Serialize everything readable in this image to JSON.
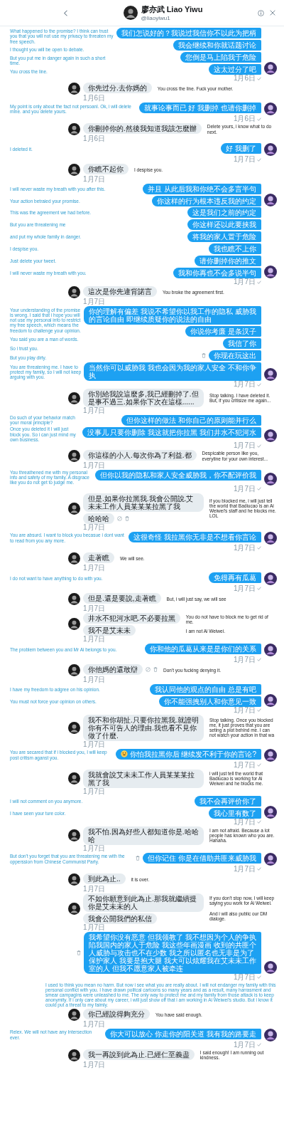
{
  "header": {
    "name": "廖亦武 Liao Yiwu",
    "handle": "@liaoyiwu1"
  },
  "blocks": [
    {
      "kind": "sent",
      "date": "1月6日",
      "read": true,
      "bubbles": [
        {
          "text": "我们怎说好的？我说过我信你不以此为把柄"
        },
        {
          "text": "我会继续和你就话题讨论"
        },
        {
          "text": "您倒是马上陷我于危险"
        },
        {
          "text": "这太过分了吧"
        }
      ],
      "notes": [
        "What happened to the promise? I think can trust you that you will not use my privacy to threaten my free speech.",
        "I thought you will be open to debate.",
        "But you put me in danger again in such a short time.",
        "You cross the line."
      ]
    },
    {
      "kind": "received",
      "date": "1月6日",
      "bubbles": [
        {
          "text": "你先过分.去你媽的"
        }
      ],
      "notes": [
        "You cross the line. Fuck your mother."
      ]
    },
    {
      "kind": "sent",
      "date": "1月6日",
      "read": true,
      "bubbles": [
        {
          "text": "就事论事而已 好 我删掉 也请你删掉"
        }
      ],
      "notes": [
        "My point is only about the fact not persoanl. Ok, i will delete mine. and you delete yours."
      ]
    },
    {
      "kind": "received",
      "date": "1月6日",
      "bubbles": [
        {
          "text": "你刪掉你的.然後我知道我該怎麼辦"
        }
      ],
      "notes": [
        "Delete yours, i know what to do next."
      ]
    },
    {
      "kind": "sent",
      "date": "1月7日",
      "read": true,
      "bubbles": [
        {
          "text": "好 我删了"
        }
      ],
      "notes": [
        "I deleted it."
      ]
    },
    {
      "kind": "received",
      "date": "1月7日",
      "bubbles": [
        {
          "text": "你瞧不起你"
        }
      ],
      "notes": [
        "I despise you."
      ]
    },
    {
      "kind": "sent",
      "bubbles": [
        {
          "text": "并且 从此后我和你绝不会多言半句"
        },
        {
          "text": "你这样的行为根本违反我的约定"
        }
      ],
      "notes": [
        "I will never waste my breath with you after this.",
        "Your action betraied your promise."
      ]
    },
    {
      "kind": "sent",
      "date": "1月7日",
      "read": true,
      "bubbles": [
        {
          "text": "这是我们之前的约定"
        },
        {
          "text": "你这样还以此要挟我"
        },
        {
          "text": "将我的家人置于危险"
        },
        {
          "text": "我也瞧不上你"
        },
        {
          "text": "请你删掉你的推文"
        },
        {
          "text": "我和你再也不会多说半句"
        }
      ],
      "notes": [
        "This was the agreement we had before.",
        "But you are threatening me",
        "and put my whole family in danger.",
        "I despise you.",
        "Just delete your tweet.",
        "I will never waste my breath with you."
      ]
    },
    {
      "kind": "received",
      "date": "1月7日",
      "bubbles": [
        {
          "text": "這次是你先違背諾言"
        }
      ],
      "notes": [
        "You broke the agreement first."
      ]
    },
    {
      "kind": "sent",
      "date": "1月7日",
      "read": true,
      "bubbles": [
        {
          "lines": [
            "你的理解有偏差 我说不希望你以我工作的隐私 威胁我",
            "的言论自由 即继续质疑你的说法的自由"
          ]
        },
        {
          "text": "你说你考廉 是条汉子"
        },
        {
          "text": "我信了你"
        },
        {
          "text": "你现在玩这出",
          "trash_icon": true
        },
        {
          "lines": [
            "当然你可以威胁我 我也会因为我的家人安全 不和你争",
            "执"
          ]
        }
      ],
      "notes": [
        "Your understanding of the promise is wrong. I said that i hope you will not use my personal info to restrict my free speech, which means the freedom to challenge your opinion.",
        "You said you are  a man of words.",
        "So i trust you.",
        "But you play dirty.",
        "You are threatening me. I have to protect my family, so I will not keep arguing with you."
      ]
    },
    {
      "kind": "received",
      "date": "1月7日",
      "bubbles": [
        {
          "text": "你別給我說這麼多,我已經刪掉了.但是事不過三.如果你下次在這樣......"
        }
      ],
      "notes": [
        "Stop talking. I have deleted it. But, if you critisize me again..."
      ]
    },
    {
      "kind": "sent",
      "date": "1月7日",
      "read": true,
      "bubbles": [
        {
          "text": "但你这样的做法 和你自己的原则能并行么"
        },
        {
          "lines": [
            "没事儿 只要你删除 我这就把你拉黑 我们井水不犯河水"
          ]
        }
      ],
      "notes": [
        "Do such of your behavior match your moral principle?",
        "Once you deleted it I will just block you. So i can just mind my own business."
      ]
    },
    {
      "kind": "received",
      "date": "1月7日",
      "bubbles": [
        {
          "text": "你這樣的小人.每次你為了利益.都"
        }
      ],
      "notes": [
        "Despicable person like you, everytine for your own interest..."
      ]
    },
    {
      "kind": "sent",
      "date": "1月7日",
      "read": true,
      "bubbles": [
        {
          "text": "但你以我的隐私和家人安全威胁我，你不配评价我"
        }
      ],
      "notes": [
        "You threathened me with my personal info and safety of my family. A disgrace like you do not get to judge me."
      ]
    },
    {
      "kind": "received",
      "date": "1月7日",
      "bubbles": [
        {
          "text": "但是.如果你拉黑我.我會公開說.艾未未工作人員某某某拉黑了我"
        },
        {
          "text": "哈哈哈",
          "block_icon": true,
          "trash_icon": true
        }
      ],
      "notes": [
        "if you blocked me, i will just tell the world that Badiucao is an Ai Weiwei's staff and he blocks me. LOL"
      ]
    },
    {
      "kind": "sent",
      "date": "1月7日",
      "read": true,
      "bubbles": [
        {
          "text": "这很奇怪 我拉黑你无非是不想看你言论"
        }
      ],
      "notes": [
        "You are absurd. I want to block you becasue i dont want to read from you any more."
      ]
    },
    {
      "kind": "received",
      "date": "1月7日",
      "bubbles": [
        {
          "text": "走著瞧"
        }
      ],
      "notes": [
        "We will see."
      ]
    },
    {
      "kind": "sent",
      "date": "1月7日",
      "read": true,
      "bubbles": [
        {
          "text": "免得再有瓜葛"
        }
      ],
      "notes": [
        "I do not want to have anything to do with you."
      ]
    },
    {
      "kind": "received",
      "date": "1月7日",
      "bubbles": [
        {
          "text": "但是.還是要說,走著瞧"
        }
      ],
      "notes": [
        "But, i will just say, we will see"
      ]
    },
    {
      "kind": "received",
      "date": "1月7日",
      "bubbles": [
        {
          "text": "井水不犯河水吧.不必要拉黑"
        },
        {
          "text": "我不是艾未未"
        }
      ],
      "notes": [
        "You do not have to block me to get rid of me.",
        "I am not Ai Weiwei."
      ]
    },
    {
      "kind": "sent",
      "date": "1月7日",
      "read": true,
      "bubbles": [
        {
          "text": "你和他的瓜葛从来是是你们的关系"
        }
      ],
      "notes": [
        "The problem between you and Mr Ai belongs to you."
      ]
    },
    {
      "kind": "received",
      "date": "1月7日",
      "bubbles": [
        {
          "text": "你他媽的還敢辯",
          "block_icon": true,
          "trash_icon": true
        }
      ],
      "notes": [
        "Don't you fucking denying it."
      ]
    },
    {
      "kind": "sent",
      "date": "1月7日",
      "read": true,
      "bubbles": [
        {
          "text": "我认同他的观点的自由 总是有吧"
        },
        {
          "text": "你不能强拽别人和你意见一致"
        }
      ],
      "notes": [
        "I have my freedom to adgree on his opinion.",
        "You must not force your opinion on others."
      ]
    },
    {
      "kind": "received",
      "date": "1月7日",
      "bubbles": [
        {
          "text": "我不和你胡扯.只要你拉黑我.就證明你有不可告人的理由.我也看不見你做了什麼."
        }
      ],
      "notes": [
        "Stop talking. Once you blocked me, it just proves that you are seting a plot behind me. I can not watch your action in that wa"
      ]
    },
    {
      "kind": "sent",
      "date": "1月7日",
      "read": true,
      "bubbles": [
        {
          "text": "你怕我拉黑你后 继续发不利于你的言论?",
          "smiley_icon": true
        }
      ],
      "notes": [
        "You are secared that if i blocked you, I will keep post critism aganst you."
      ]
    },
    {
      "kind": "received",
      "date": "1月7日",
      "bubbles": [
        {
          "text": "我就會說艾未未工作人員某某某拉黑了我"
        }
      ],
      "notes": [
        "i will just tell the world that Badiucao is working for Ai Weiwei and he blocks me."
      ]
    },
    {
      "kind": "sent",
      "date": "1月7日",
      "read": true,
      "bubbles": [
        {
          "text": "我不会再评价你了"
        },
        {
          "text": "我心里有数了"
        }
      ],
      "notes": [
        "I will not comment on you anymore.",
        "I have seen your ture color."
      ]
    },
    {
      "kind": "received",
      "date": "1月7日",
      "bubbles": [
        {
          "text": "我不怕.因為好些人都知道你是.哈哈哈"
        }
      ],
      "notes": [
        "I am not afraid. Because a lot people has known who you are. Hahaha."
      ]
    },
    {
      "kind": "sent",
      "date": "1月7日",
      "read": true,
      "bubbles": [
        {
          "text": "但你记住 你是在借助共匪来威胁我",
          "trash_icon": true
        }
      ],
      "notes": [
        "But don't you forget that you are threatening me with the opperssion from Chinese Communist Party."
      ]
    },
    {
      "kind": "received",
      "date": "1月7日",
      "bubbles": [
        {
          "text": "到此為止.."
        }
      ],
      "notes": [
        "it is over."
      ]
    },
    {
      "kind": "received",
      "date": "1月7日",
      "bubbles": [
        {
          "text": "不如你願意到此為止.那我就繼續提你是艾未未的人"
        },
        {
          "text": "我會公開我們的私信"
        }
      ],
      "notes": [
        "If you don't stop now, I will keep saying you work for Ai Weiwei.",
        "And i will also public our DM dialoge."
      ]
    },
    {
      "kind": "sent",
      "date": "1月7日",
      "read": true,
      "bubbles": [
        {
          "lines": [
            "我希望你没有恶意 但我领教了 我不想因为个人的争执",
            "陷我国内的家人于危险 我这些年画漫画 收到的共匪个",
            "人威胁与攻击也不在少数 我之所以匿名也无非是为了",
            "保护家人  我要是抱大腿 我大可以炫耀我在艾未未工作",
            "室的人 但我不愿意家人被牵连"
          ],
          "trash_icon": true
        }
      ],
      "notes_below": [
        "I used to think you mean no harm. But now i see what you are really about. I will not endanger my family with this personal conflict with you. I have drawn politcal cartoons so many years and as a result, many harrasment and smear campagins were unleashed to me. The only way to protect me and my family from those attack is to keep anonymity. If i only care about my career, i will just show off that i am working in Ai Weiwei's studio. But i know it could put a threat to my faimly."
      ]
    },
    {
      "kind": "received",
      "date": "1月7日",
      "bubbles": [
        {
          "text": "你已經說得夠充分"
        }
      ],
      "notes": [
        "You have said enough."
      ]
    },
    {
      "kind": "sent",
      "date": "1月7日",
      "read": true,
      "bubbles": [
        {
          "text": "你大可以放心 你走你的阳关道 我有我的路要走"
        }
      ],
      "notes": [
        "Relex. We will not have any Intersection ever."
      ]
    },
    {
      "kind": "received",
      "date": "1月7日",
      "bubbles": [
        {
          "text": "我一再說到此為止.已經仁至義盡"
        }
      ],
      "notes": [
        "I said enough! I am running out kindness."
      ]
    }
  ]
}
